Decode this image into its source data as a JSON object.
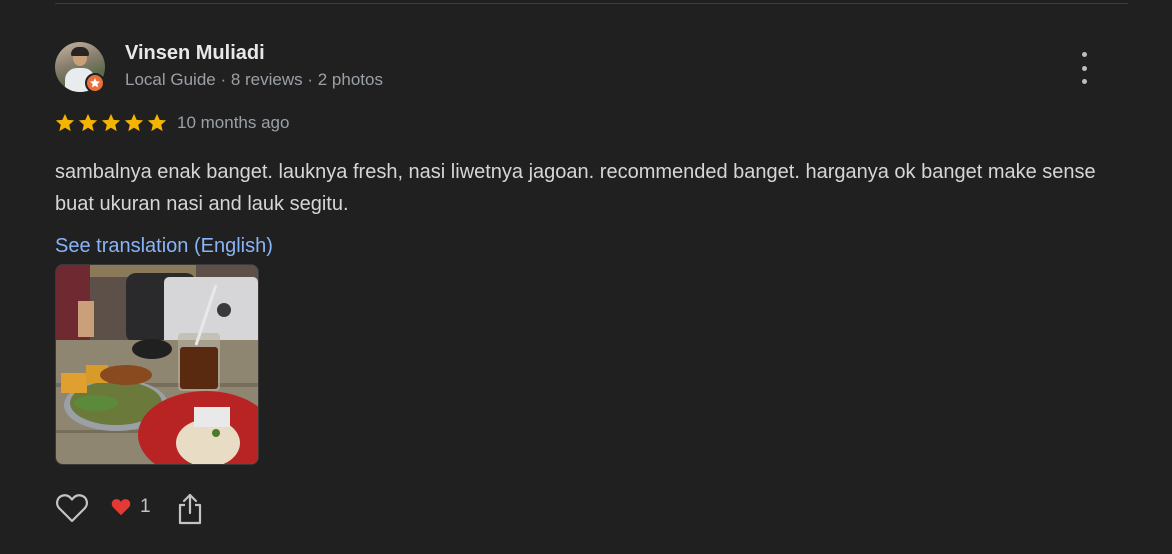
{
  "reviewer": {
    "name": "Vinsen Muliadi",
    "meta": "Local Guide · 8 reviews · 2 photos"
  },
  "rating": {
    "stars": 5,
    "max": 5,
    "date": "10 months ago"
  },
  "review": {
    "text": "sambalnya enak banget. lauknya fresh, nasi liwetnya jagoan. recommended banget. harganya ok banget make sense buat ukuran nasi and lauk segitu.",
    "translate_link": "See translation (English)"
  },
  "photos": {
    "count": 1
  },
  "reactions": {
    "heart_count": "1"
  },
  "colors": {
    "background": "#202020",
    "star": "#f4b400",
    "link": "#8ab4f8",
    "badge": "#e8703a",
    "reaction_heart": "#e53935"
  },
  "icons": {
    "menu": "more-vert-icon",
    "like": "heart-outline-icon",
    "reaction": "heart-filled-icon",
    "share": "share-icon",
    "badge": "local-guide-star-icon"
  }
}
